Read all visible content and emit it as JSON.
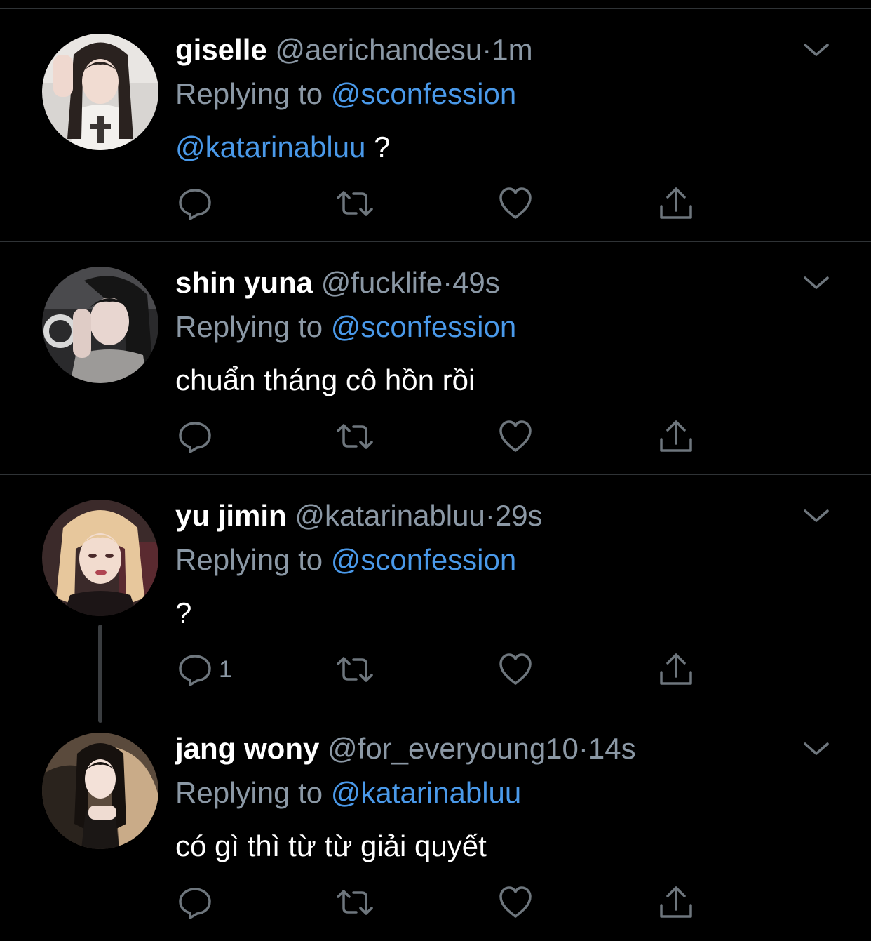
{
  "colors": {
    "background": "#000000",
    "name": "#ffffff",
    "secondary": "#8b98a5",
    "link": "#4a99e9",
    "divider": "#2f3336"
  },
  "tweets": [
    {
      "name": "giselle",
      "handle": "@aerichandesu",
      "separator": "·",
      "time": "1m",
      "replying_prefix": "Replying to ",
      "replying_to": "@sconfession",
      "body_mention": "@katarinabluu",
      "body_text": " ?",
      "reply_count": "",
      "icons": [
        "reply-icon",
        "retweet-icon",
        "like-icon",
        "share-icon",
        "chevron-down-icon"
      ]
    },
    {
      "name": "shin yuna",
      "handle": "@fucklife",
      "separator": "·",
      "time": "49s",
      "replying_prefix": "Replying to ",
      "replying_to": "@sconfession",
      "body_mention": "",
      "body_text": "chuẩn tháng cô hồn rồi",
      "reply_count": "",
      "icons": [
        "reply-icon",
        "retweet-icon",
        "like-icon",
        "share-icon",
        "chevron-down-icon"
      ]
    },
    {
      "name": "yu jimin",
      "handle": "@katarinabluu",
      "separator": "·",
      "time": "29s",
      "replying_prefix": "Replying to ",
      "replying_to": "@sconfession",
      "body_mention": "",
      "body_text": "?",
      "reply_count": "1",
      "icons": [
        "reply-icon",
        "retweet-icon",
        "like-icon",
        "share-icon",
        "chevron-down-icon"
      ]
    },
    {
      "name": "jang wony",
      "handle": "@for_everyoung10",
      "separator": "·",
      "time": "14s",
      "replying_prefix": "Replying to ",
      "replying_to": "@katarinabluu",
      "body_mention": "",
      "body_text": "có gì thì từ từ giải quyết",
      "reply_count": "",
      "icons": [
        "reply-icon",
        "retweet-icon",
        "like-icon",
        "share-icon",
        "chevron-down-icon"
      ]
    }
  ]
}
